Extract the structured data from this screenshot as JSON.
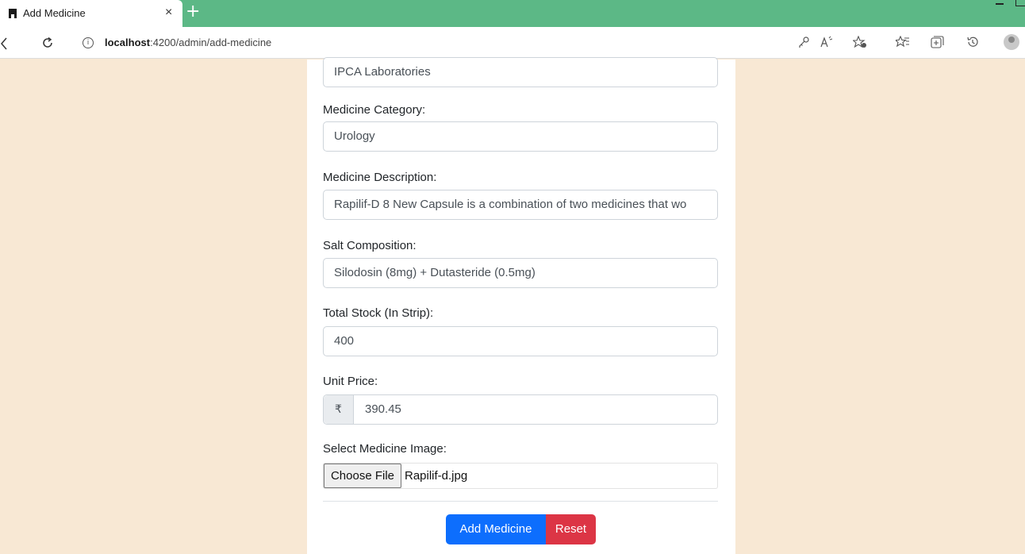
{
  "browser": {
    "tab_title": "Add Medicine",
    "close_glyph": "×",
    "new_tab_glyph": "+",
    "url_host": "localhost",
    "url_path": ":4200/admin/add-medicine",
    "info_glyph": "i",
    "icons": [
      "key-icon",
      "read-aloud-icon",
      "favorite-add-icon",
      "favorites-icon",
      "collections-icon",
      "history-icon",
      "profile-avatar-icon"
    ],
    "accent_color": "#5cb886"
  },
  "form": {
    "manufacturer_value": "IPCA Laboratories",
    "category_label": "Medicine Category:",
    "category_value": "Urology",
    "description_label": "Medicine Description:",
    "description_value": "Rapilif-D 8 New Capsule is a combination of two medicines that wo",
    "salt_label": "Salt Composition:",
    "salt_value": "Silodosin (8mg) + Dutasteride (0.5mg)",
    "stock_label": "Total Stock (In Strip):",
    "stock_value": "400",
    "price_label": "Unit Price:",
    "price_currency": "₹",
    "price_value": "390.45",
    "image_label": "Select Medicine Image:",
    "choose_file_label": "Choose File",
    "file_name": "Rapilif-d.jpg",
    "add_button": "Add Medicine",
    "reset_button": "Reset"
  },
  "colors": {
    "page_background": "#f8e8d4",
    "primary": "#0d6efd",
    "danger": "#dc3545"
  }
}
